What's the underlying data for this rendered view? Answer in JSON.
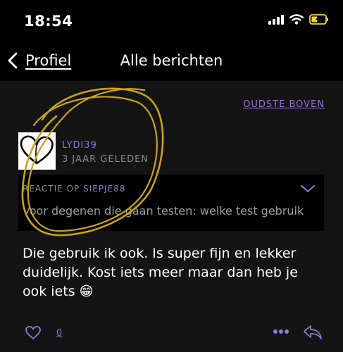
{
  "status": {
    "time": "18:54"
  },
  "nav": {
    "back_label": "Profiel",
    "title": "Alle berichten"
  },
  "sort": {
    "label": "OUDSTE BOVEN"
  },
  "post": {
    "username": "LYDI39",
    "time_ago": "3 JAAR GELEDEN",
    "quote_prefix": "REACTIE OP ",
    "quote_user": "SIEPJE88",
    "quote_text": "Voor degenen die gaan testen: welke test gebruik",
    "body": "Die gebruik ik ook. Is super fijn en lekker duidelijk. Kost iets meer maar dan heb je ook iets 😁",
    "like_count": "0"
  },
  "colors": {
    "accent": "#8f7ad8",
    "battery": "#f4d23c",
    "annotation": "#c9a21b",
    "background": "#000000",
    "panel": "#141414"
  }
}
